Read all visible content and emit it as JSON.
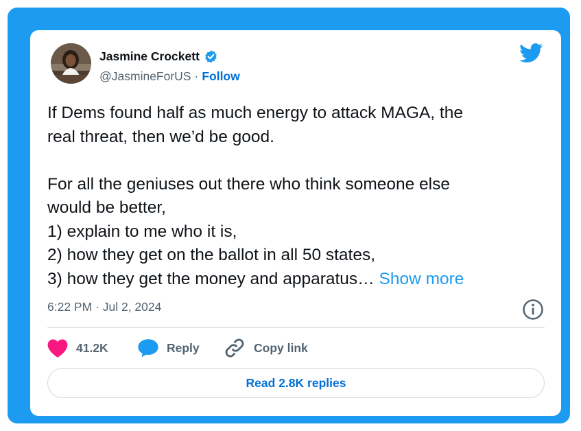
{
  "author": {
    "name": "Jasmine Crockett",
    "handle": "@JasmineForUS",
    "separator": "·",
    "follow_label": "Follow",
    "verified": true
  },
  "tweet": {
    "line1": "If Dems found half as much energy to attack MAGA, the",
    "line2": "real threat, then we’d be good.",
    "line3": "For all the geniuses out there who think someone else",
    "line4": "would be better,",
    "line5": "1) explain to me who it is,",
    "line6": "2) how they get on the ballot in all 50 states,",
    "line7": "3) how they get the money and apparatus…",
    "show_more_label": "Show more"
  },
  "meta": {
    "timestamp": "6:22 PM · Jul 2, 2024"
  },
  "actions": {
    "likes": "41.2K",
    "reply_label": "Reply",
    "copy_link_label": "Copy link"
  },
  "footer": {
    "read_replies_label": "Read 2.8K replies"
  },
  "colors": {
    "frame": "#1d9bf0",
    "link": "#006fd6",
    "show_more": "#1d9bf0",
    "like": "#f91880",
    "text": "#0f1419",
    "muted": "#536471"
  },
  "icons": {
    "avatar": "avatar",
    "verified": "verified-badge-icon",
    "logo": "twitter-bird-icon",
    "info": "info-icon",
    "like": "heart-icon",
    "reply": "speech-bubble-icon",
    "copy": "link-icon"
  }
}
